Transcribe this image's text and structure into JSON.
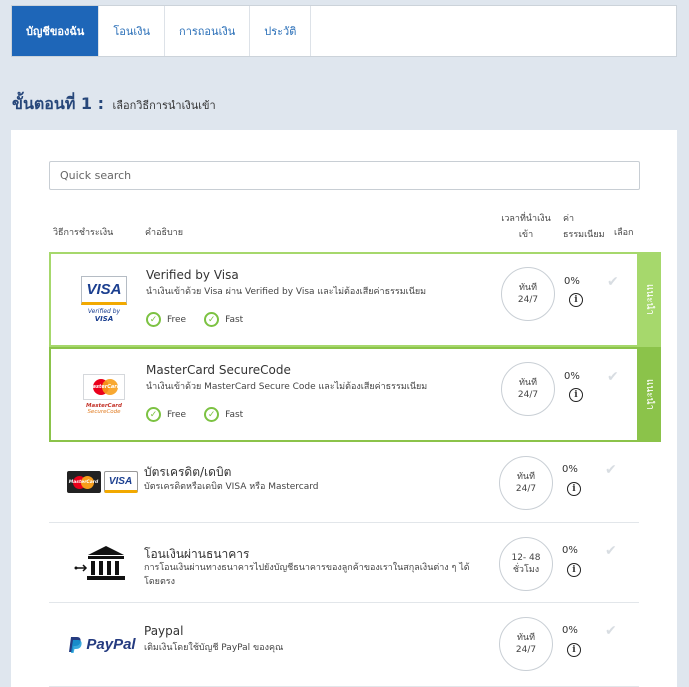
{
  "tabs": [
    {
      "label": "บัญชีของฉัน",
      "active": true
    },
    {
      "label": "โอนเงิน",
      "active": false
    },
    {
      "label": "การถอนเงิน",
      "active": false
    },
    {
      "label": "ประวัติ",
      "active": false
    }
  ],
  "step": {
    "prefix": "ขั้นตอนที่ 1 :",
    "text": "เลือกวิธีการนำเงินเข้า"
  },
  "search": {
    "placeholder": "Quick search"
  },
  "headers": {
    "method": "วิธีการชำระเงิน",
    "description": "คำอธิบาย",
    "time_line1": "เวลาที่นำเงิน",
    "time_line2": "เข้า",
    "fee_line1": "ค่า",
    "fee_line2": "ธรรมเนียม",
    "select": "เลือก"
  },
  "side_tab_label": "แนะนำ",
  "methods": [
    {
      "logo": "visa-logo",
      "logo_text": "VISA",
      "logo_sub1": "Verified by",
      "logo_sub2": "VISA",
      "name": "Verified by Visa",
      "desc": "นำเงินเข้าด้วย Visa ผ่าน Verified by Visa และไม่ต้องเสียค่าธรรมเนียม",
      "tags": [
        "Free",
        "Fast"
      ],
      "time_line1": "ทันที",
      "time_line2": "24/7",
      "fee": "0%"
    },
    {
      "logo": "mastercard-securecode-logo",
      "logo_text": "MasterCard",
      "logo_sub1": "MasterCard",
      "logo_sub2": "SecureCode",
      "name": "MasterCard SecureCode",
      "desc": "นำเงินเข้าด้วย MasterCard Secure Code และไม่ต้องเสียค่าธรรมเนียม",
      "tags": [
        "Free",
        "Fast"
      ],
      "time_line1": "ทันที",
      "time_line2": "24/7",
      "fee": "0%"
    },
    {
      "logo": "card-logos",
      "logo_text": "MasterCard",
      "logo_sub1": "VISA",
      "logo_sub2": "",
      "name": "บัตรเครดิต/เดบิต",
      "desc": "บัตรเครดิตหรือเดบิต VISA หรือ Mastercard",
      "tags": [],
      "time_line1": "ทันที",
      "time_line2": "24/7",
      "fee": "0%"
    },
    {
      "logo": "bank-icon",
      "logo_text": "",
      "logo_sub1": "",
      "logo_sub2": "",
      "name": "โอนเงินผ่านธนาคาร",
      "desc": "การโอนเงินผ่านทางธนาคารไปยังบัญชีธนาคารของลูกค้าของเราในสกุลเงินต่าง ๆ ได้โดยตรง",
      "tags": [],
      "time_line1": "12- 48",
      "time_line2": "ชั่วโมง",
      "fee": "0%"
    },
    {
      "logo": "paypal-logo",
      "logo_text": "PayPal",
      "logo_sub1": "",
      "logo_sub2": "",
      "name": "Paypal",
      "desc": "เติมเงินโดยใช้บัญชี PayPal ของคุณ",
      "tags": [],
      "time_line1": "ทันที",
      "time_line2": "24/7",
      "fee": "0%"
    }
  ]
}
